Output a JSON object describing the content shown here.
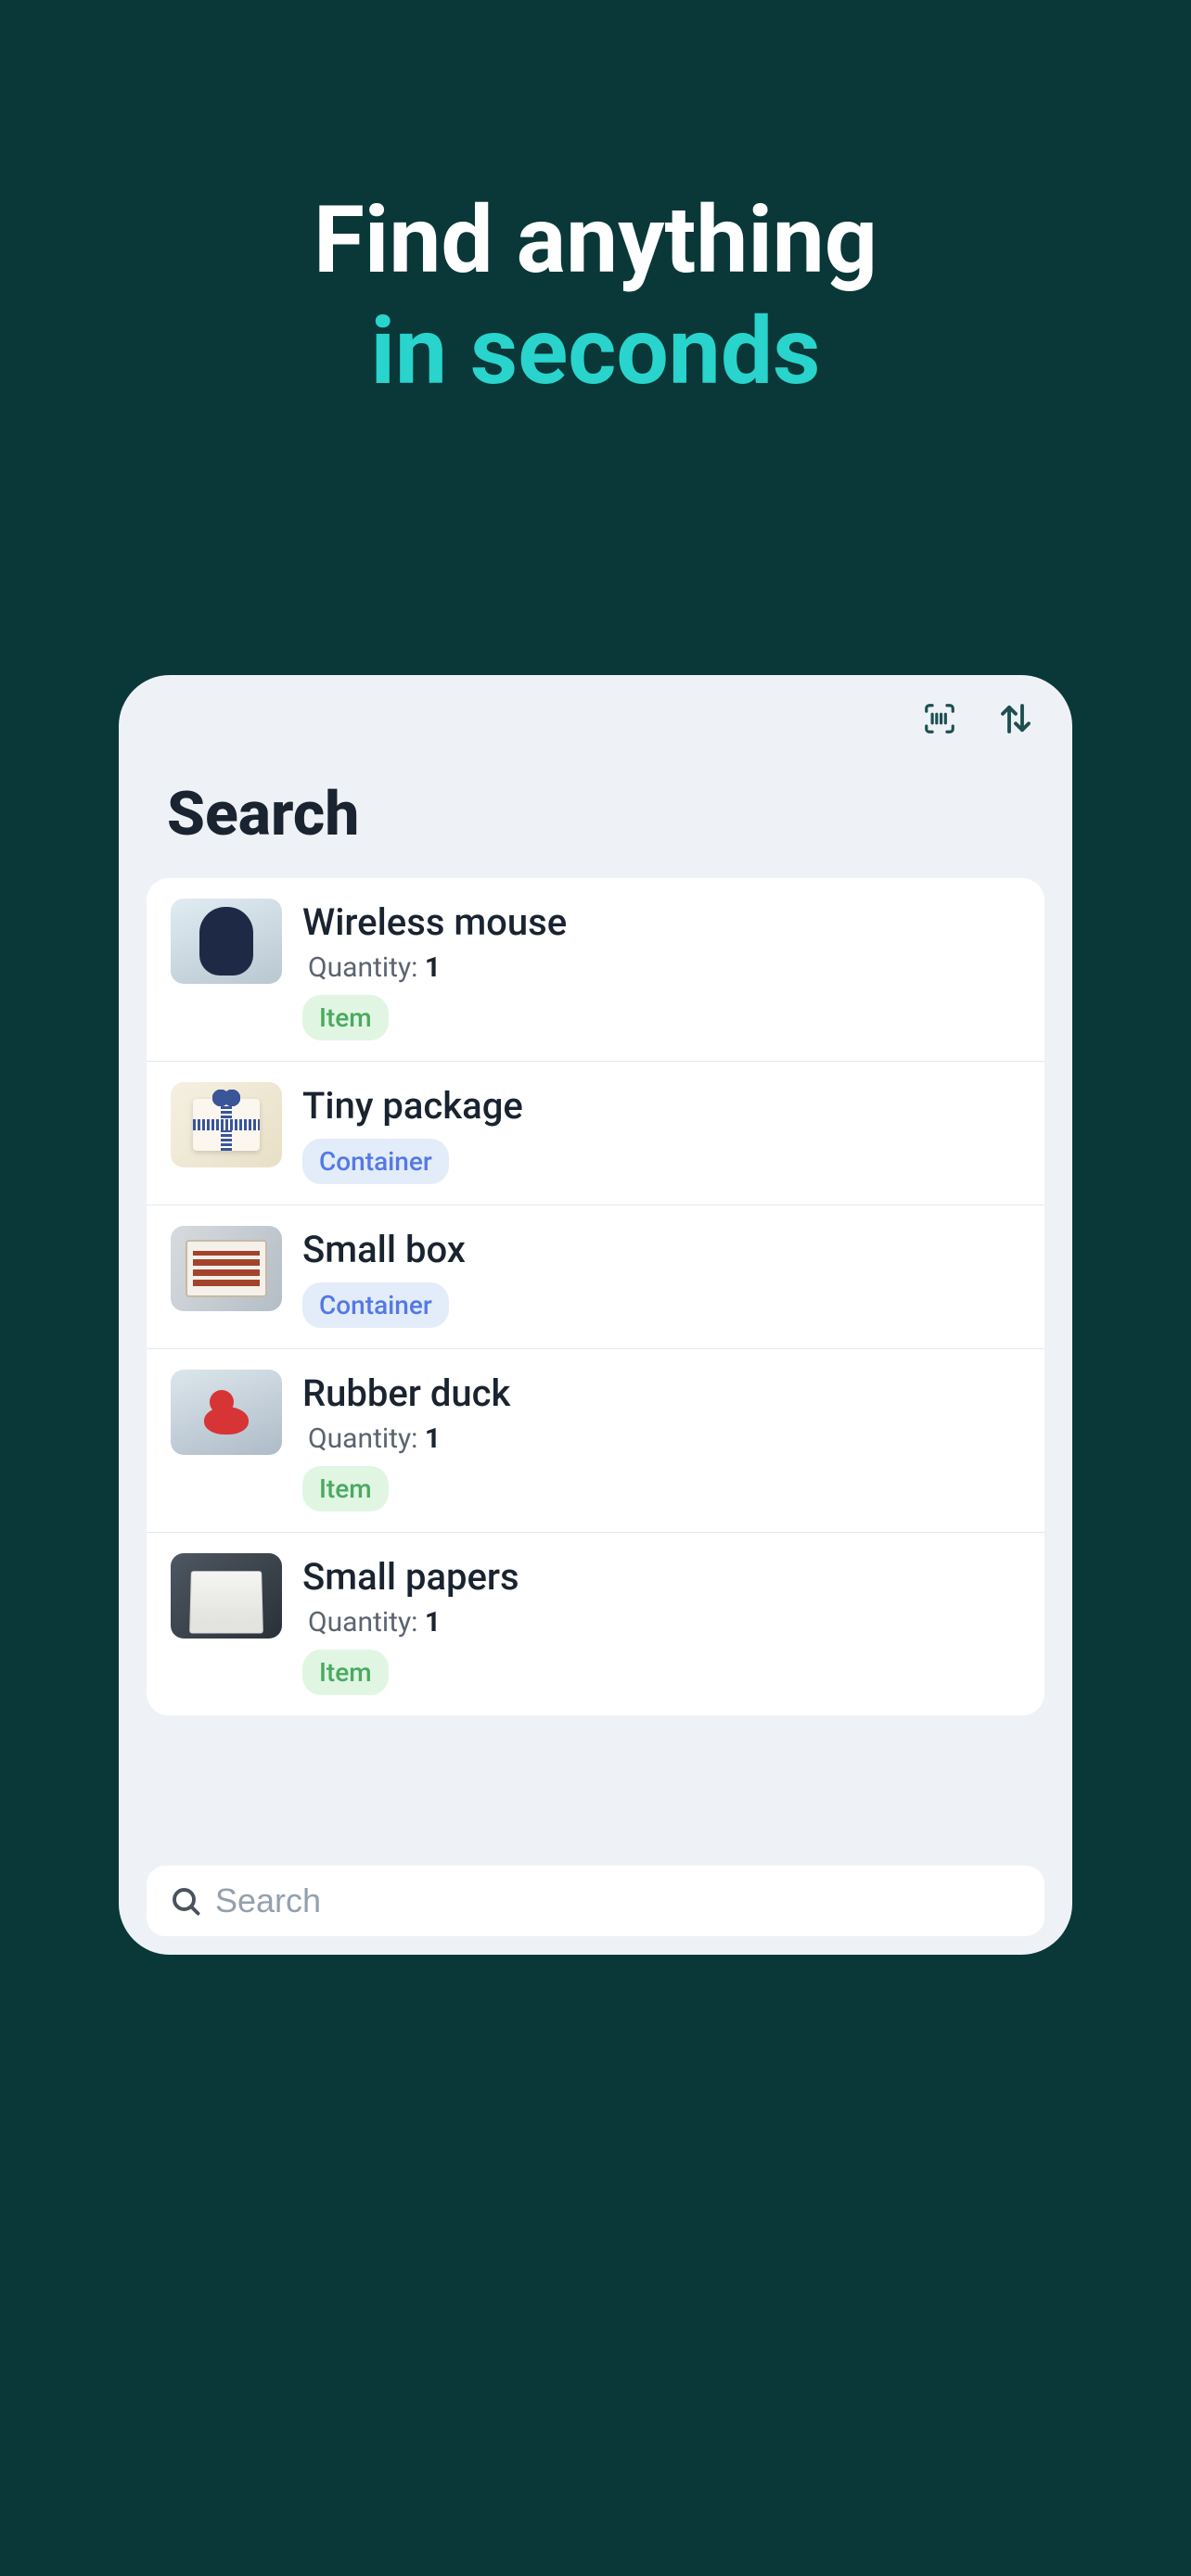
{
  "hero": {
    "line1": "Find anything",
    "line2": "in seconds"
  },
  "page": {
    "title": "Search"
  },
  "search": {
    "placeholder": "Search"
  },
  "badges": {
    "item": "Item",
    "container": "Container"
  },
  "results": [
    {
      "title": "Wireless mouse",
      "qty_label": "Quantity:",
      "qty": "1",
      "type": "item",
      "thumb": "mouse"
    },
    {
      "title": "Tiny package",
      "type": "container",
      "thumb": "package"
    },
    {
      "title": "Small box",
      "type": "container",
      "thumb": "box"
    },
    {
      "title": "Rubber duck",
      "qty_label": "Quantity:",
      "qty": "1",
      "type": "item",
      "thumb": "duck"
    },
    {
      "title": "Small papers",
      "qty_label": "Quantity:",
      "qty": "1",
      "type": "item",
      "thumb": "papers"
    }
  ]
}
